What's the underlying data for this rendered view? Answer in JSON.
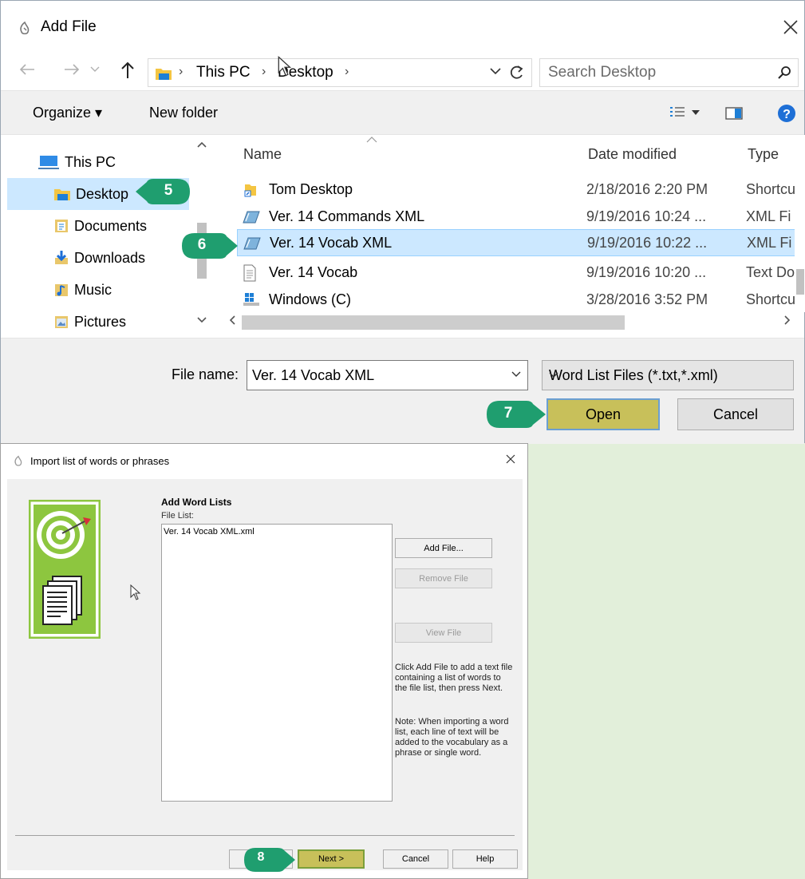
{
  "add_file_dialog": {
    "title": "Add File",
    "address_bar": {
      "crumbs": [
        "This PC",
        "Desktop"
      ]
    },
    "search": {
      "placeholder": "Search Desktop"
    },
    "toolbar": {
      "organize": "Organize ▾",
      "new_folder": "New folder"
    },
    "nav_tree": {
      "items": [
        {
          "label": "This PC",
          "icon": "computer-icon"
        },
        {
          "label": "Desktop",
          "icon": "desktop-folder-icon",
          "selected": true
        },
        {
          "label": "Documents",
          "icon": "documents-icon"
        },
        {
          "label": "Downloads",
          "icon": "downloads-icon"
        },
        {
          "label": "Music",
          "icon": "music-icon"
        },
        {
          "label": "Pictures",
          "icon": "pictures-icon"
        }
      ]
    },
    "columns": {
      "name": "Name",
      "date": "Date modified",
      "type": "Type"
    },
    "files": [
      {
        "name": "Tom Desktop",
        "date": "2/18/2016 2:20 PM",
        "type": "Shortcu",
        "icon": "shortcut-folder-icon"
      },
      {
        "name": "Ver. 14 Commands XML",
        "date": "9/19/2016 10:24 ...",
        "type": "XML Fi",
        "icon": "xml-file-icon"
      },
      {
        "name": "Ver. 14 Vocab XML",
        "date": "9/19/2016 10:22 ...",
        "type": "XML Fi",
        "icon": "xml-file-icon",
        "selected": true
      },
      {
        "name": "Ver. 14 Vocab",
        "date": "9/19/2016 10:20 ...",
        "type": "Text Do",
        "icon": "text-file-icon"
      },
      {
        "name": "Windows (C)",
        "date": "3/28/2016 3:52 PM",
        "type": "Shortcu",
        "icon": "drive-shortcut-icon"
      }
    ],
    "file_name_label": "File name:",
    "file_name_value": "Ver. 14 Vocab XML",
    "file_type_value": "Word List Files (*.txt,*.xml)",
    "open_label": "Open",
    "cancel_label": "Cancel"
  },
  "import_dialog": {
    "title": "Import list of words or phrases",
    "heading": "Add Word Lists",
    "file_list_label": "File List:",
    "file_list_items": [
      "Ver. 14 Vocab XML.xml"
    ],
    "add_file_label": "Add File...",
    "remove_file_label": "Remove File",
    "view_file_label": "View File",
    "note1": "Click Add File to add a text file containing a list of words to the file list, then press Next.",
    "note2": "Note: When importing a word list, each line of text will be added to the vocabulary as a phrase or single word.",
    "back_label": "",
    "next_label": "Next >",
    "cancel_label": "Cancel",
    "help_label": "Help"
  },
  "callouts": [
    "5",
    "6",
    "7",
    "8"
  ],
  "colors": {
    "callout": "#1f9e6f",
    "highlight_button": "#c8c05a",
    "selection": "#cce8ff",
    "background": "#e2efda"
  }
}
